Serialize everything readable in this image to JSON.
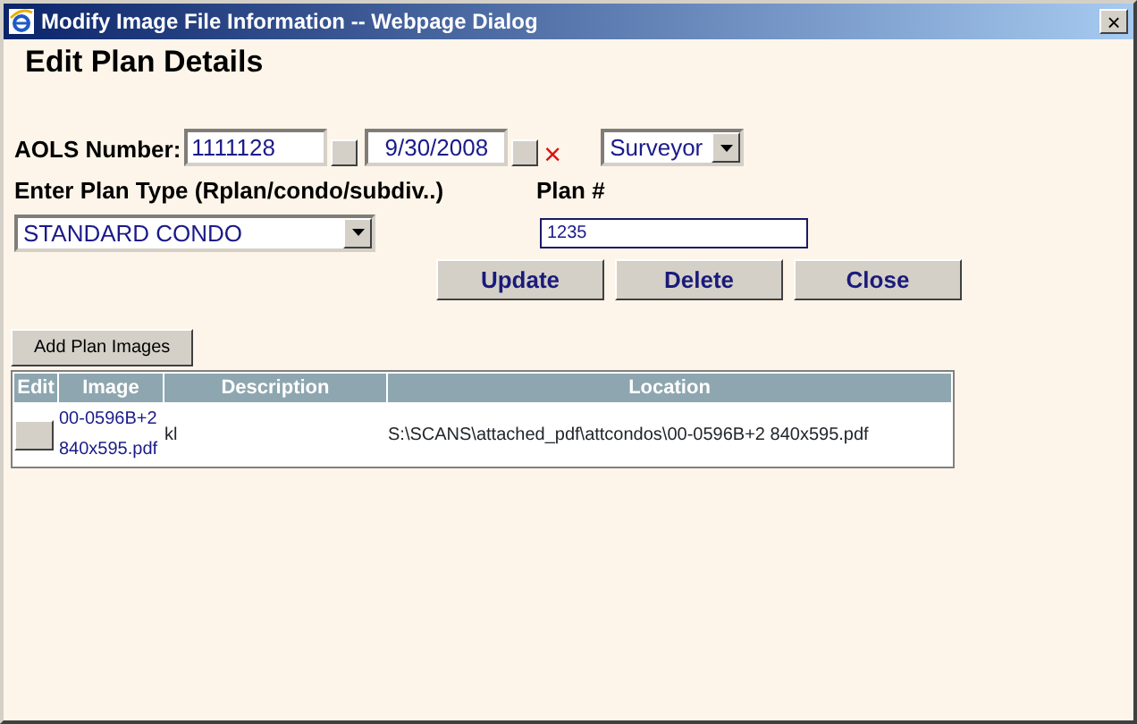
{
  "window": {
    "title": "Modify Image File Information -- Webpage Dialog",
    "close": "×"
  },
  "heading": "Edit Plan Details",
  "aols": {
    "label": "AOLS Number:",
    "value": "1111128"
  },
  "date": {
    "value": "9/30/2008",
    "clear": "×"
  },
  "role": {
    "value": "Surveyor"
  },
  "plan_type": {
    "label": "Enter Plan Type (Rplan/condo/subdiv..)",
    "value": "STANDARD CONDO"
  },
  "plan_number": {
    "label": "Plan #",
    "value": "1235"
  },
  "buttons": [
    "Update",
    "Delete",
    "Close"
  ],
  "add_button": "Add Plan Images",
  "table": {
    "columns": [
      "Edit",
      "Image",
      "Description",
      "Location"
    ],
    "rows": [
      {
        "image": "00-0596B+2 840x595.pdf",
        "description": "kl",
        "location": "S:\\SCANS\\attached_pdf\\attcondos\\00-0596B+2 840x595.pdf"
      }
    ]
  }
}
